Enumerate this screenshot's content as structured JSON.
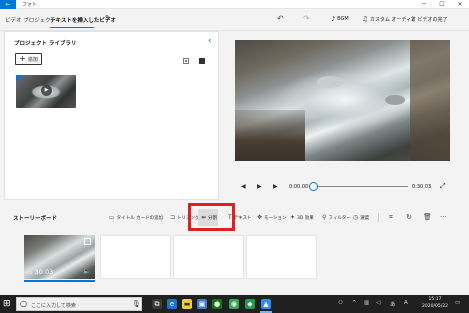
{
  "titlebar": {
    "back": "←",
    "app_name": "フォト",
    "minimize": "─",
    "maximize": "☐",
    "close": "✕"
  },
  "header": {
    "breadcrumb_parent": "ビデオ プロジェクト",
    "project_name": "テキストを挿入したビデオ",
    "edit_icon": "✎",
    "undo_icon": "↶",
    "redo_icon": "↷",
    "bgm_label": "BGM",
    "custom_audio_label": "カスタム オーディオ",
    "finish_video_label": "ビデオの完了",
    "more_icon": "···"
  },
  "library": {
    "title": "プロジェクト ライブラリ",
    "collapse_icon": "‹",
    "add_label": "追加",
    "add_icon": "+",
    "thumb_play_icon": "▶"
  },
  "playback": {
    "rewind_icon": "◀",
    "play_icon": "▶",
    "forward_icon": "▶",
    "time_current": "0:00.00",
    "time_total": "0:30.03",
    "progress": 0.0,
    "fullscreen_icon": "⤢"
  },
  "storyboard": {
    "title": "ストーリーボード",
    "tools": {
      "title_card": "タイトル カードの追加",
      "trim": "トリミング",
      "split": "分割",
      "text": "テキスト",
      "motion": "モーション",
      "effects_3d": "3D 効果",
      "filter": "フィルター",
      "speed": "速度"
    },
    "clip": {
      "duration": "30.03"
    }
  },
  "taskbar": {
    "search_placeholder": "ここに入力して検索",
    "clock_time": "15:17",
    "clock_date": "2020/05/22"
  },
  "colors": {
    "accent": "#0078d7",
    "highlight": "#e02020",
    "taskbar": "#202020"
  }
}
